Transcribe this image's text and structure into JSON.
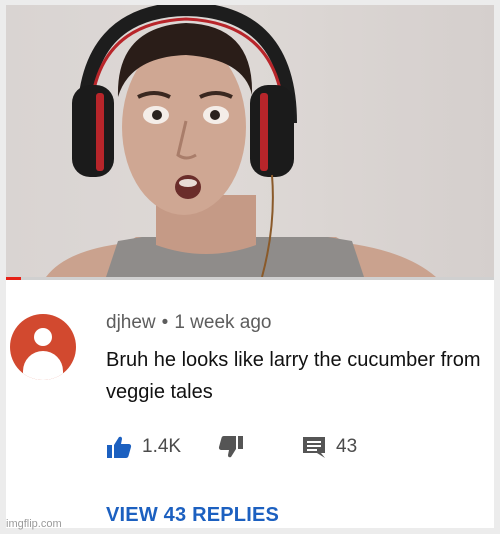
{
  "video": {
    "progress": 0.03,
    "progress_color": "#e62117"
  },
  "comment": {
    "username": "djhew",
    "separator": "•",
    "timestamp": "1 week ago",
    "text": "Bruh he looks like larry the cucumber from veggie tales",
    "avatar_color": "#d2492f",
    "likes": "1.4K",
    "replies_count": "43",
    "view_replies_label": "VIEW 43 REPLIES",
    "like_color": "#1c60c0",
    "icons": {
      "like": "thumbs-up-icon",
      "dislike": "thumbs-down-icon",
      "reply": "comment-icon"
    }
  },
  "watermark": "imgflip.com"
}
